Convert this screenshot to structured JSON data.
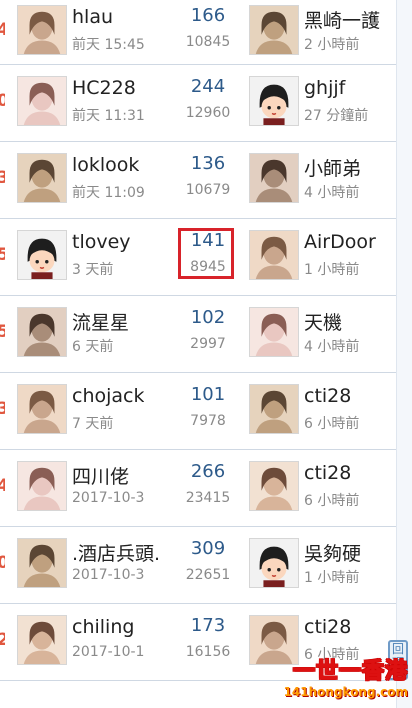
{
  "rows": [
    {
      "rank_edge": "4",
      "left_avatar": "avatar-photo",
      "name": "hlau",
      "time": "前天 15:45",
      "topics": "166",
      "views": "10845",
      "right_avatar": "avatar-photo",
      "right_name": "黑崎一護",
      "right_time": "2 小時前"
    },
    {
      "rank_edge": "0",
      "left_avatar": "avatar-photo",
      "name": "HC228",
      "time": "前天 11:31",
      "topics": "244",
      "views": "12960",
      "right_avatar": "default-avatar",
      "right_name": "ghjjf",
      "right_time": "27 分鐘前"
    },
    {
      "rank_edge": "3",
      "left_avatar": "avatar-photo",
      "name": "loklook",
      "time": "前天 11:09",
      "topics": "136",
      "views": "10679",
      "right_avatar": "avatar-photo",
      "right_name": "小師弟",
      "right_time": "4 小時前"
    },
    {
      "rank_edge": "5",
      "left_avatar": "default-avatar",
      "name": "tlovey",
      "time": "3 天前",
      "topics": "141",
      "views": "8945",
      "right_avatar": "avatar-photo",
      "right_name": "AirDoor",
      "right_time": "1 小時前"
    },
    {
      "rank_edge": "5",
      "left_avatar": "avatar-photo",
      "name": "流星星",
      "time": "6 天前",
      "topics": "102",
      "views": "2997",
      "right_avatar": "avatar-photo",
      "right_name": "天機",
      "right_time": "4 小時前"
    },
    {
      "rank_edge": "3",
      "left_avatar": "avatar-photo",
      "name": "chojack",
      "time": "7 天前",
      "topics": "101",
      "views": "7978",
      "right_avatar": "avatar-photo",
      "right_name": "cti28",
      "right_time": "6 小時前"
    },
    {
      "rank_edge": "4",
      "left_avatar": "avatar-photo",
      "name": "四川佬",
      "time": "2017-10-3",
      "topics": "266",
      "views": "23415",
      "right_avatar": "avatar-photo",
      "right_name": "cti28",
      "right_time": "6 小時前"
    },
    {
      "rank_edge": "0",
      "left_avatar": "avatar-photo",
      "name": ".酒店兵頭.",
      "time": "2017-10-3",
      "topics": "309",
      "views": "22651",
      "right_avatar": "default-avatar",
      "right_name": "吳夠硬",
      "right_time": "1 小時前"
    },
    {
      "rank_edge": "2",
      "left_avatar": "avatar-photo",
      "name": "chiling",
      "time": "2017-10-1",
      "topics": "173",
      "views": "16156",
      "right_avatar": "avatar-photo",
      "right_name": "cti28",
      "right_time": "6 小時前"
    }
  ],
  "highlighted_value": "141",
  "watermark": {
    "line1": "一世一香港",
    "line2": "141hongkong.com"
  },
  "scroll_tab": {
    "label": "回頂"
  },
  "colors": {
    "topic_count": "#2d5a8a",
    "muted": "#8a8a8a",
    "highlight_border": "#d8232a",
    "rank_edge": "#e0573f"
  }
}
